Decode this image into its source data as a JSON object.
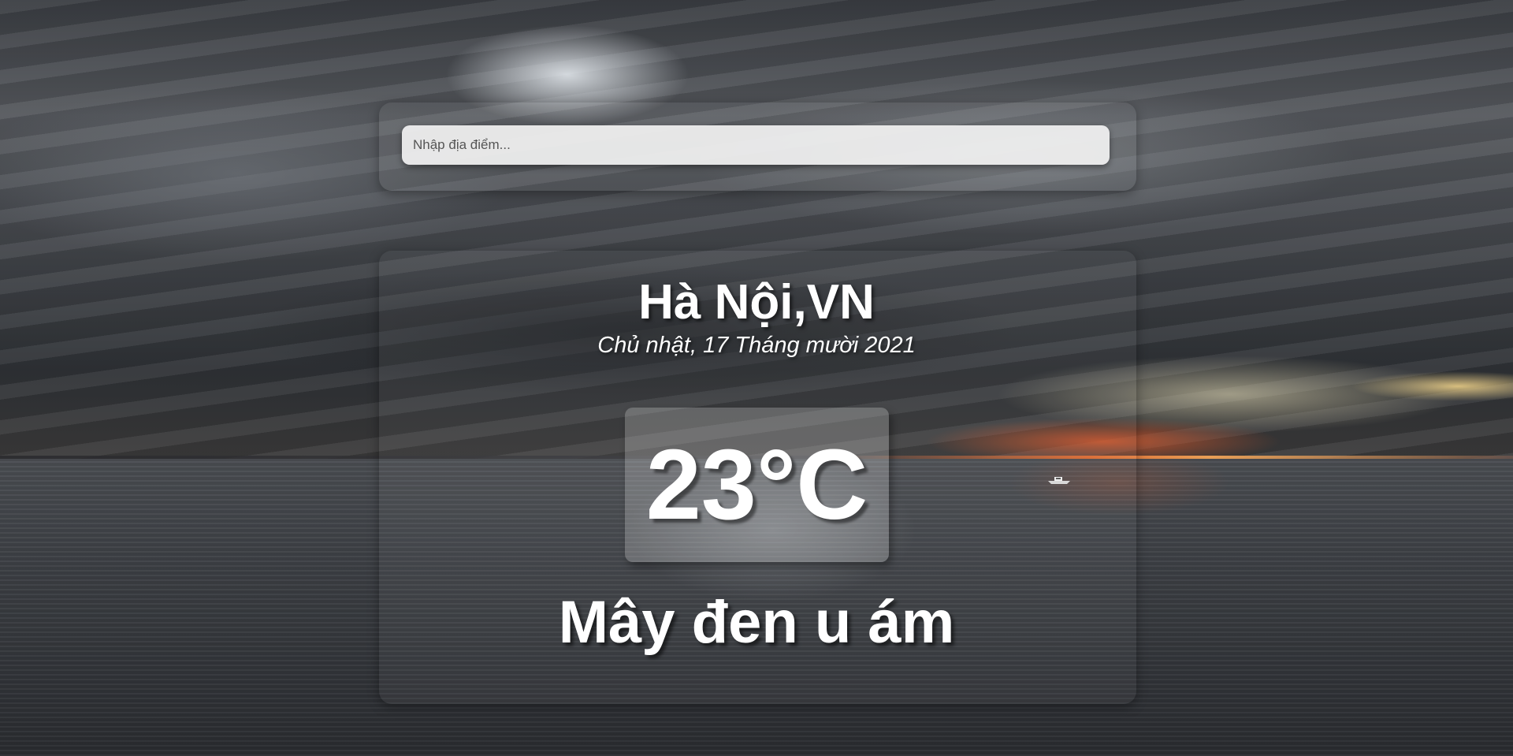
{
  "search": {
    "placeholder": "Nhập địa điểm..."
  },
  "weather": {
    "location": "Hà Nội,VN",
    "date": "Chủ nhật, 17 Tháng mười 2021",
    "temperature": "23°C",
    "description": "Mây đen u ám"
  }
}
